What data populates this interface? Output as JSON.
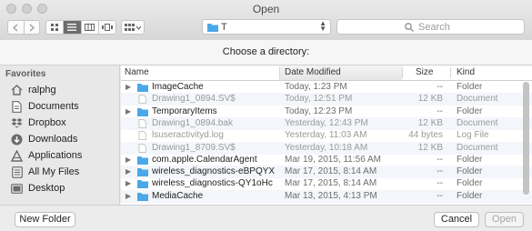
{
  "window": {
    "title": "Open"
  },
  "toolbar": {
    "path": "T",
    "search_placeholder": "Search"
  },
  "prompt": "Choose a directory:",
  "sidebar": {
    "heading": "Favorites",
    "items": [
      {
        "label": "ralphg",
        "icon": "home-icon"
      },
      {
        "label": "Documents",
        "icon": "documents-icon"
      },
      {
        "label": "Dropbox",
        "icon": "dropbox-icon"
      },
      {
        "label": "Downloads",
        "icon": "downloads-icon"
      },
      {
        "label": "Applications",
        "icon": "applications-icon"
      },
      {
        "label": "All My Files",
        "icon": "all-files-icon"
      },
      {
        "label": "Desktop",
        "icon": "desktop-icon"
      }
    ]
  },
  "list": {
    "columns": {
      "name": "Name",
      "date": "Date Modified",
      "size": "Size",
      "kind": "Kind"
    },
    "rows": [
      {
        "name": "ImageCache",
        "date": "Today, 1:23 PM",
        "size": "--",
        "kind": "Folder",
        "type": "folder"
      },
      {
        "name": "Drawing1_0894.SV$",
        "date": "Today, 12:51 PM",
        "size": "12 KB",
        "kind": "Document",
        "type": "doc"
      },
      {
        "name": "TemporaryItems",
        "date": "Today, 12:23 PM",
        "size": "--",
        "kind": "Folder",
        "type": "folder"
      },
      {
        "name": "Drawing1_0894.bak",
        "date": "Yesterday, 12:43 PM",
        "size": "12 KB",
        "kind": "Document",
        "type": "doc"
      },
      {
        "name": "lsuseractivityd.log",
        "date": "Yesterday, 11:03 AM",
        "size": "44 bytes",
        "kind": "Log File",
        "type": "doc"
      },
      {
        "name": "Drawing1_8709.SV$",
        "date": "Yesterday, 10:18 AM",
        "size": "12 KB",
        "kind": "Document",
        "type": "doc"
      },
      {
        "name": "com.apple.CalendarAgent",
        "date": "Mar 19, 2015, 11:56 AM",
        "size": "--",
        "kind": "Folder",
        "type": "folder"
      },
      {
        "name": "wireless_diagnostics-eBPQYX",
        "date": "Mar 17, 2015, 8:14 AM",
        "size": "--",
        "kind": "Folder",
        "type": "folder"
      },
      {
        "name": "wireless_diagnostics-QY1oHc",
        "date": "Mar 17, 2015, 8:14 AM",
        "size": "--",
        "kind": "Folder",
        "type": "folder"
      },
      {
        "name": "MediaCache",
        "date": "Mar 13, 2015, 4:13 PM",
        "size": "--",
        "kind": "Folder",
        "type": "folder"
      }
    ]
  },
  "buttons": {
    "new_folder": "New Folder",
    "cancel": "Cancel",
    "open": "Open"
  },
  "colors": {
    "folder": "#4aa8e8",
    "selected_segment": "#6e6e6e"
  }
}
